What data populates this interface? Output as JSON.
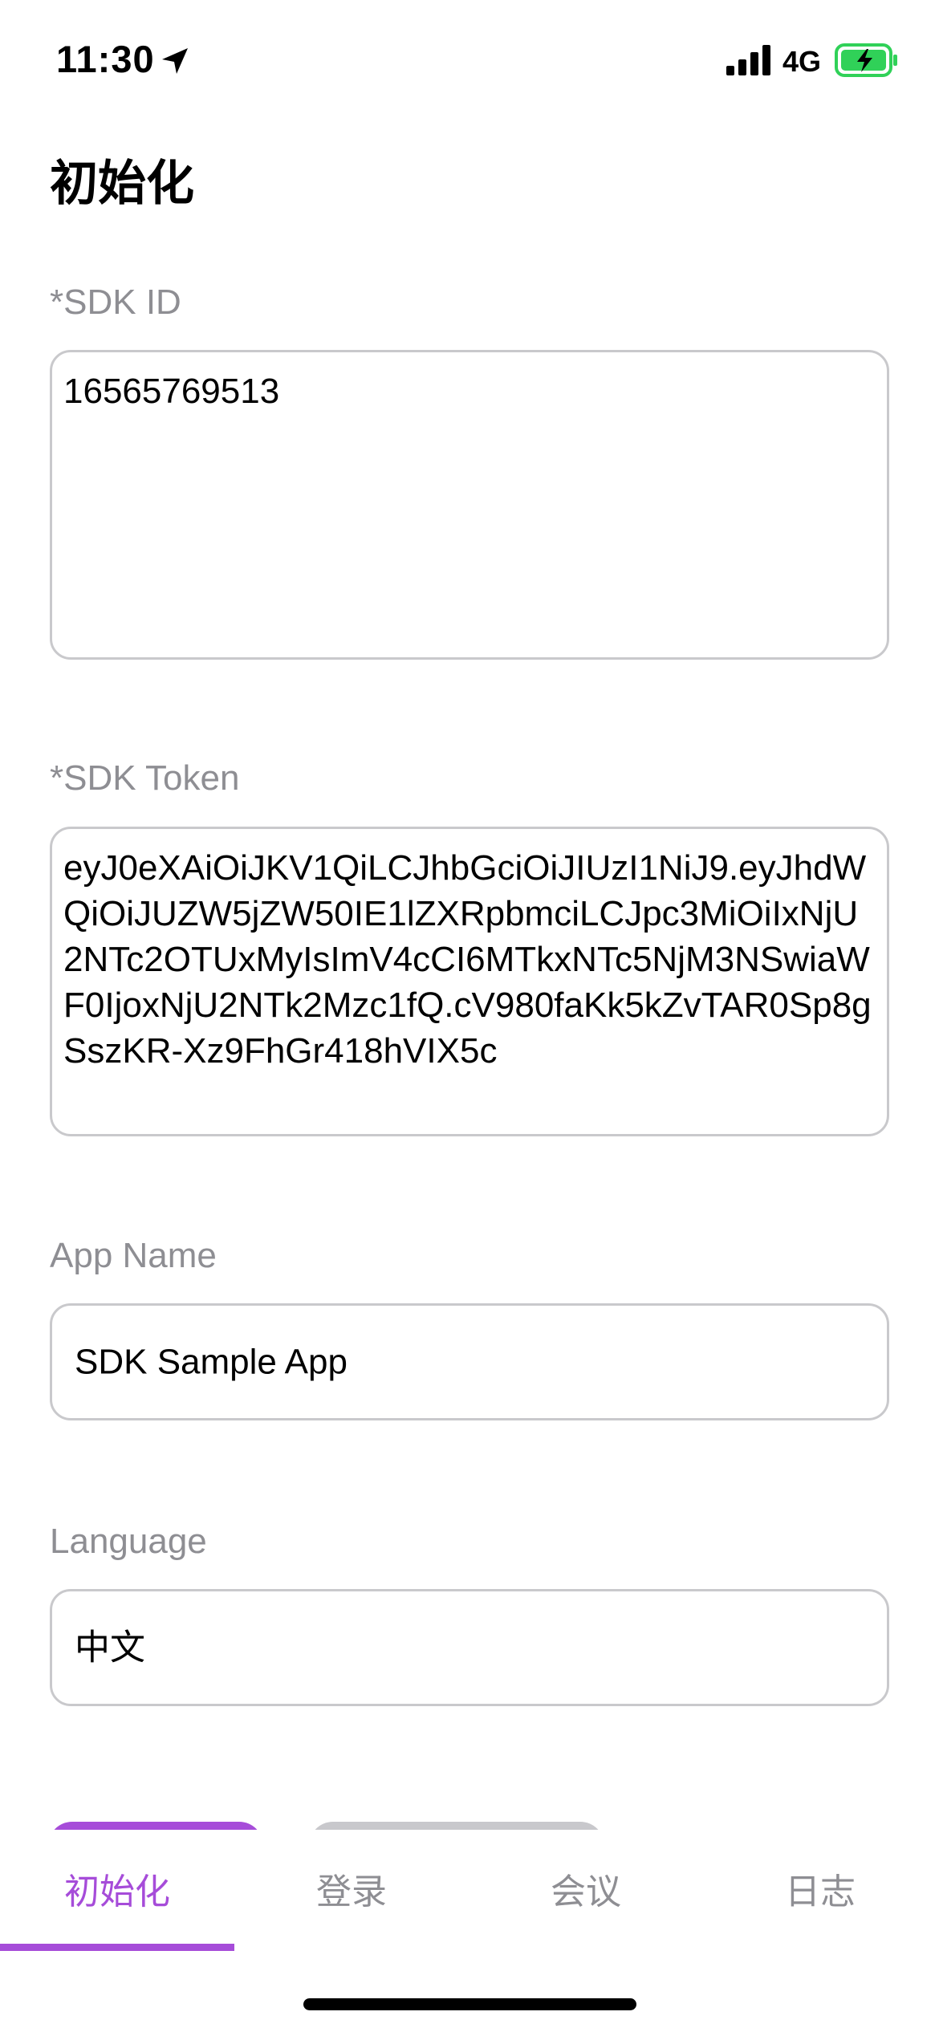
{
  "status_bar": {
    "time": "11:30",
    "network": "4G",
    "icons": [
      "location-arrow-icon",
      "signal-bars-icon",
      "battery-charging-icon"
    ],
    "battery_color": "#30d158"
  },
  "header": {
    "title": "初始化"
  },
  "form": {
    "sdk_id": {
      "label": "*SDK ID",
      "value": "16565769513"
    },
    "sdk_token": {
      "label": "*SDK Token",
      "value": "eyJ0eXAiOiJKV1QiLCJhbGciOiJIUzI1NiJ9.eyJhdWQiOiJUZW5jZW50IE1lZXRpbmciLCJpc3MiOiIxNjU2NTc2OTUxMyIsImV4cCI6MTkxNTc5NjM3NSwiaWF0IjoxNjU2NTk2Mzc1fQ.cV980faKk5kZvTAR0Sp8gSszKR-Xz9FhGr418hVIX5c"
    },
    "app_name": {
      "label": "App Name",
      "value": "SDK Sample App"
    },
    "language": {
      "label": "Language",
      "value": "中文"
    }
  },
  "tabs": [
    {
      "label": "初始化",
      "active": true
    },
    {
      "label": "登录",
      "active": false
    },
    {
      "label": "会议",
      "active": false
    },
    {
      "label": "日志",
      "active": false
    }
  ],
  "colors": {
    "accent": "#a64cd9",
    "secondary_button": "#c8c8cc",
    "label_gray": "#8e8e93",
    "border_gray": "#c9c9cc"
  }
}
